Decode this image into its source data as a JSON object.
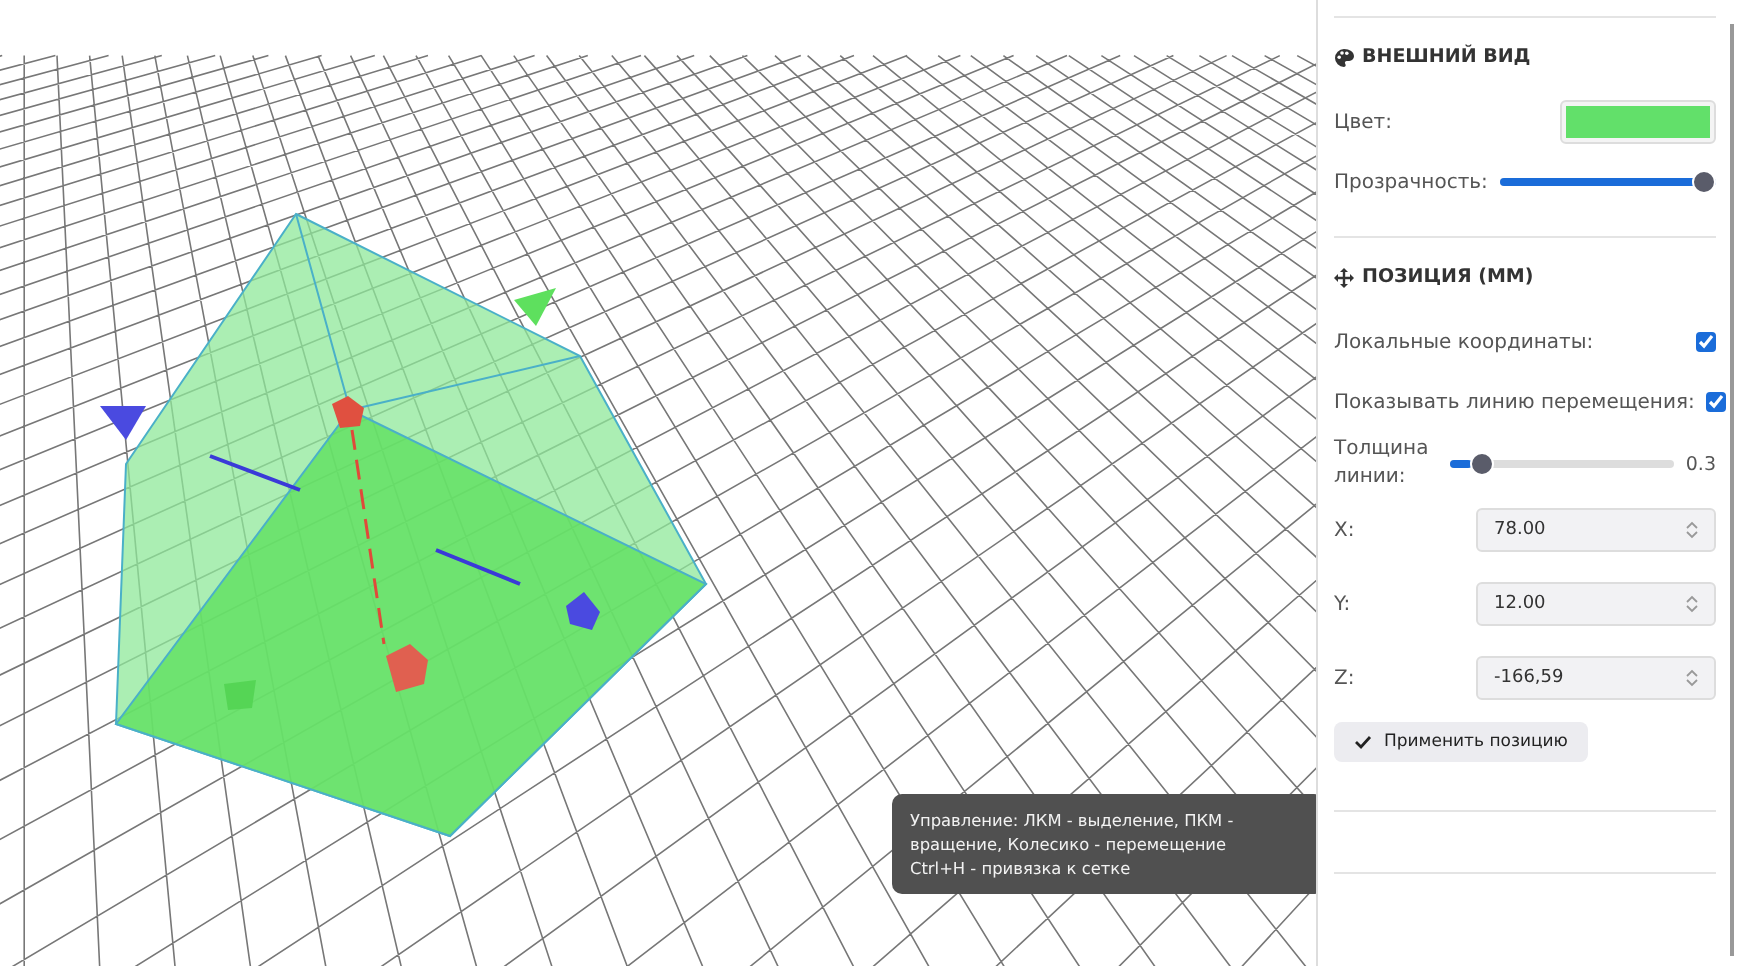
{
  "appearance": {
    "title": "ВНЕШНИЙ ВИД",
    "color_label": "Цвет:",
    "color": "#62e06a",
    "opacity": {
      "label": "Прозрачность:",
      "level": 1.0
    }
  },
  "position": {
    "title": "ПОЗИЦИЯ (ММ)",
    "options": [
      {
        "label": "Локальные координаты:",
        "checked": true
      },
      {
        "label": "Показывать линию перемещения:",
        "checked": true
      }
    ],
    "line_width": {
      "label": "Толщина линии:",
      "level": 0.1,
      "reading": "0.3"
    },
    "fields": [
      {
        "label": "X:",
        "value": "78.00"
      },
      {
        "label": "Y:",
        "value": "12.00"
      },
      {
        "label": "Z:",
        "value": "-166,59"
      }
    ],
    "apply_button": "Применить позицию"
  },
  "hint": {
    "lines": [
      "Управление: ЛКМ - выделение, ПКМ - вращение, Колесико - перемещение",
      "Ctrl+H - привязка к сетке"
    ]
  }
}
